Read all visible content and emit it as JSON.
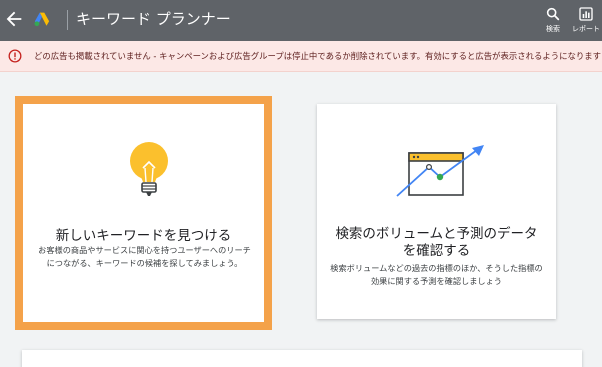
{
  "header": {
    "title": "キーワード プランナー",
    "tools": {
      "search_label": "検索",
      "report_label": "レポート"
    }
  },
  "alert": {
    "message": "どの広告も掲載されていません - キャンペーンおよび広告グループは停止中であるか削除されています。有効にすると広告が表示されるようになります"
  },
  "cards": {
    "find_keywords": {
      "title": "新しいキーワードを見つける",
      "description": "お客様の商品やサービスに関心を持つユーザーへのリーチにつながる、キーワードの候補を探してみましょう。"
    },
    "volume_forecast": {
      "title": "検索のボリュームと予測のデータを確認する",
      "description": "検索ボリュームなどの過去の指標のほか、そうした指標の効果に関する予測を確認しましょう"
    }
  },
  "colors": {
    "header_bg": "#5f6368",
    "alert_bg": "#fce8e6",
    "alert_icon": "#c5221f",
    "highlight_border": "#f4a24a",
    "bulb": "#fbc02d",
    "chart_arrow": "#4285f4",
    "chart_point": "#34a853"
  }
}
